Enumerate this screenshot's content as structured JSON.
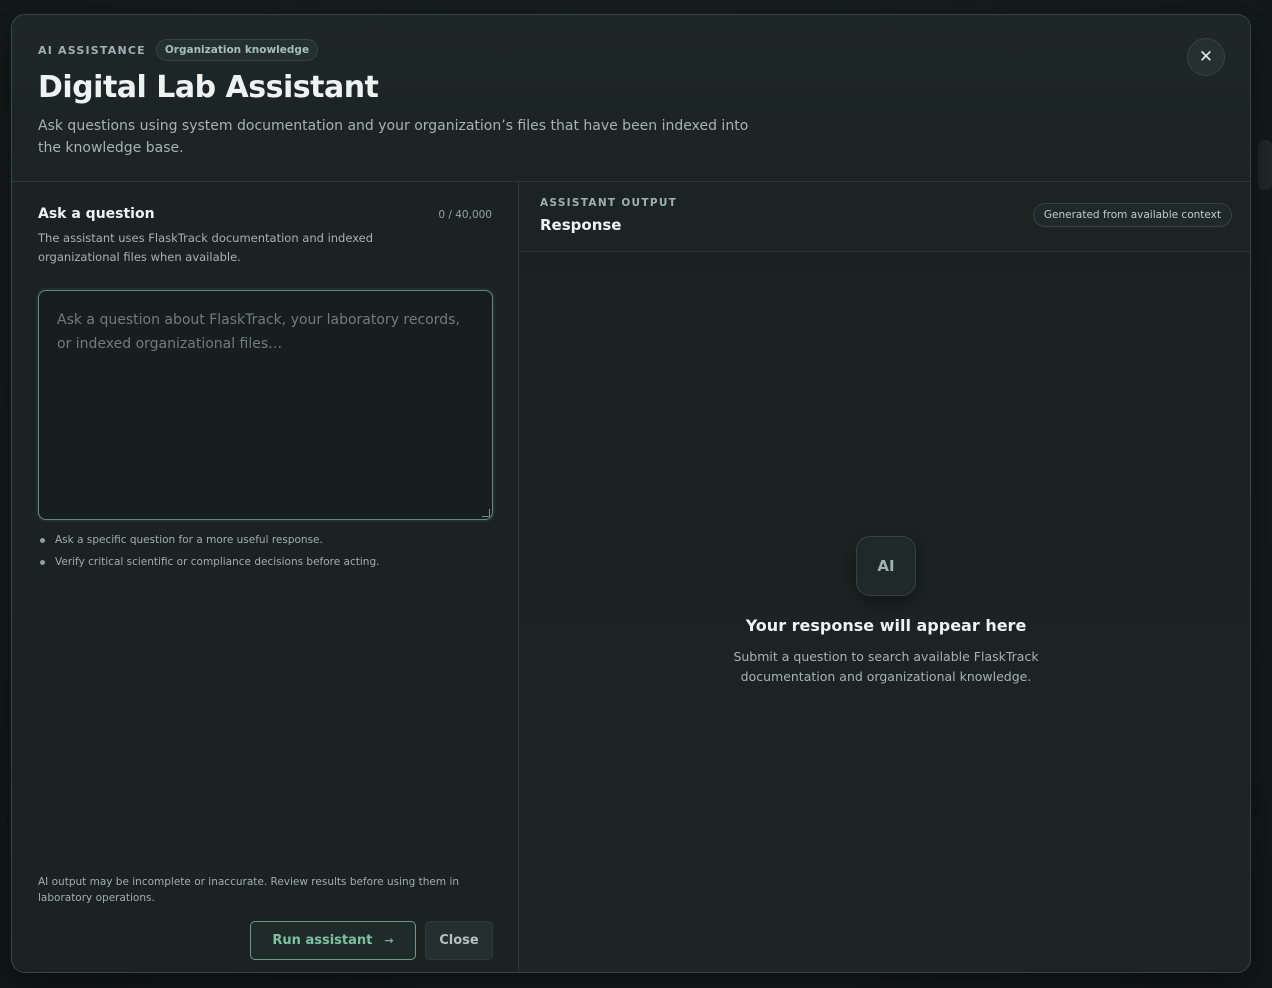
{
  "header": {
    "eyebrow": "AI ASSISTANCE",
    "badge": "Organization knowledge",
    "title": "Digital Lab Assistant",
    "subtitle": "Ask questions using system documentation and your organization’s files that have been indexed into the knowledge base.",
    "close_icon": "✕"
  },
  "question_panel": {
    "title": "Ask a question",
    "counter": "0 / 40,000",
    "description": "The assistant uses FlaskTrack documentation and indexed organizational files when available.",
    "input_value": "",
    "input_placeholder": "Ask a question about FlaskTrack, your laboratory records, or indexed organizational files…",
    "tips": [
      "Ask a specific question for a more useful response.",
      "Verify critical scientific or compliance decisions before acting."
    ],
    "disclaimer": "AI output may be incomplete or inaccurate. Review results before using them in laboratory operations.",
    "run_label": "Run assistant",
    "run_arrow": "→",
    "close_label": "Close"
  },
  "output_panel": {
    "eyebrow": "ASSISTANT OUTPUT",
    "title": "Response",
    "badge": "Generated from available context",
    "empty_icon": "AI",
    "empty_title": "Your response will appear here",
    "empty_description": "Submit a question to search available FlaskTrack documentation and organizational knowledge."
  },
  "colors": {
    "accent": "#7fc0a4",
    "background": "#1b2323"
  }
}
